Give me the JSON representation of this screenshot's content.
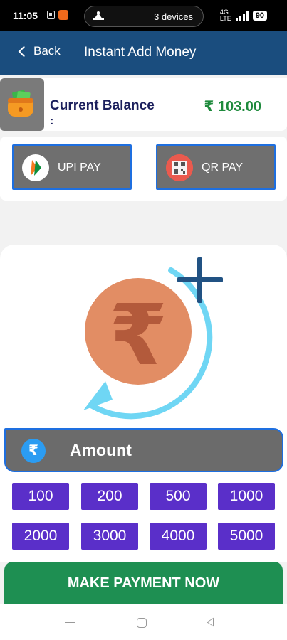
{
  "status_bar": {
    "time": "11:05",
    "devices": "3 devices",
    "network": "VoLTE",
    "network_top": "4G",
    "network_bottom": "LTE",
    "battery": "90"
  },
  "header": {
    "back_label": "Back",
    "title": "Instant Add Money",
    "color": "#1a4d7e"
  },
  "balance": {
    "label": "Current Balance",
    "colon": ":",
    "value": "₹ 103.00",
    "value_color": "#1e8a3c"
  },
  "payment_methods": [
    {
      "label": "UPI PAY",
      "icon": "upi-icon"
    },
    {
      "label": "QR PAY",
      "icon": "qr-code-icon"
    }
  ],
  "amount": {
    "label": "Amount",
    "currency_symbol": "₹",
    "presets": [
      "100",
      "200",
      "500",
      "1000",
      "2000",
      "3000",
      "4000",
      "5000"
    ],
    "chip_color": "#5a2fc9"
  },
  "cta": {
    "label": "MAKE PAYMENT NOW",
    "color": "#1e8f52"
  },
  "hero": {
    "icon": "rupee-add-illustration",
    "currency_symbol": "₹"
  },
  "nav": {
    "items": [
      "menu-icon",
      "home-icon",
      "back-icon"
    ]
  }
}
